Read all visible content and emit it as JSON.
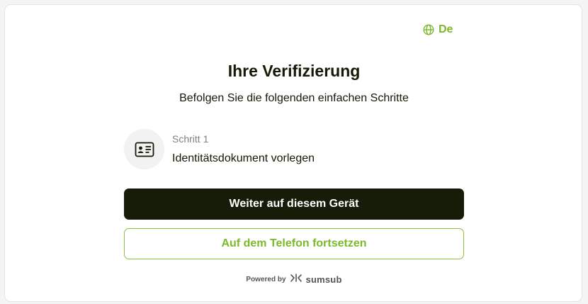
{
  "header": {
    "language_label": "De",
    "language_icon": "globe-icon"
  },
  "main": {
    "title": "Ihre Verifizierung",
    "subtitle": "Befolgen Sie die folgenden einfachen Schritte",
    "steps": [
      {
        "label": "Schritt 1",
        "name": "Identitätsdokument vorlegen",
        "icon": "id-card-icon"
      }
    ],
    "primary_button_label": "Weiter auf diesem Gerät",
    "secondary_button_label": "Auf dem Telefon fortsetzen"
  },
  "footer": {
    "powered_by": "Powered by",
    "brand": "sumsub",
    "brand_icon": "sumsub-logo-icon"
  },
  "colors": {
    "accent": "#7db82b",
    "primary_button_bg": "#161c07",
    "text": "#141a05"
  }
}
